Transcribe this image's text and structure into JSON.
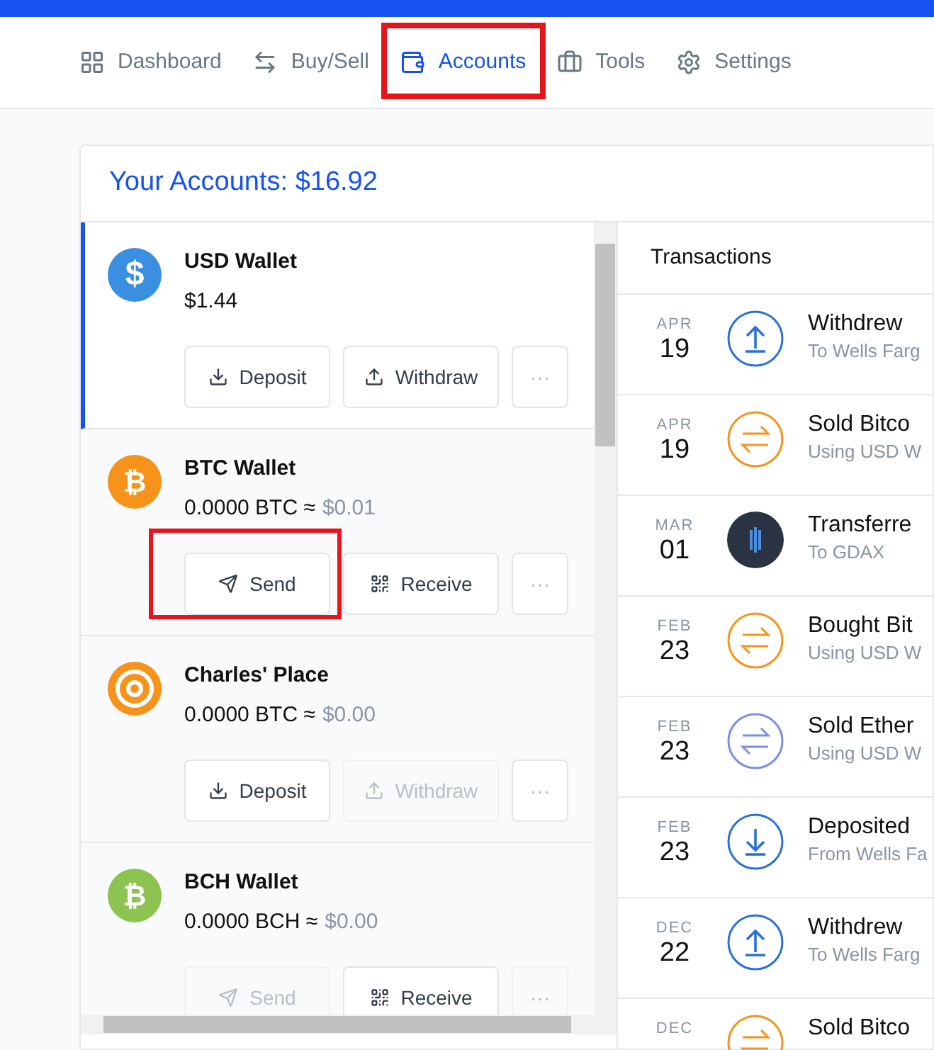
{
  "nav": [
    {
      "kind": "dashboard",
      "label": "Dashboard",
      "selected": false,
      "highlighted": false
    },
    {
      "kind": "buysell",
      "label": "Buy/Sell",
      "selected": false,
      "highlighted": false
    },
    {
      "kind": "accounts",
      "label": "Accounts",
      "selected": true,
      "highlighted": true
    },
    {
      "kind": "tools",
      "label": "Tools",
      "selected": false,
      "highlighted": false
    },
    {
      "kind": "settings",
      "label": "Settings",
      "selected": false,
      "highlighted": false
    }
  ],
  "accounts_title": "Your Accounts: $16.92",
  "accounts": [
    {
      "kind": "usd",
      "symbol": "$",
      "name": "USD Wallet",
      "amount": "$1.44",
      "selected": true,
      "buttons": [
        {
          "kind": "deposit",
          "label": "Deposit",
          "disabled": false,
          "highlighted": false
        },
        {
          "kind": "withdraw",
          "label": "Withdraw",
          "disabled": false,
          "highlighted": false
        },
        {
          "kind": "more",
          "label": "···",
          "disabled": false,
          "highlighted": false
        }
      ]
    },
    {
      "kind": "btc",
      "symbol": "₿",
      "name": "BTC Wallet",
      "amount": "0.0000 BTC ≈",
      "fiat": "$0.01",
      "selected": false,
      "buttons": [
        {
          "kind": "send",
          "label": "Send",
          "disabled": false,
          "highlighted": true
        },
        {
          "kind": "receive",
          "label": "Receive",
          "disabled": false,
          "highlighted": false
        },
        {
          "kind": "more",
          "label": "···",
          "disabled": false,
          "highlighted": false
        }
      ]
    },
    {
      "kind": "vault",
      "name": "Charles' Place",
      "amount": "0.0000 BTC ≈",
      "fiat": "$0.00",
      "selected": false,
      "buttons": [
        {
          "kind": "deposit",
          "label": "Deposit",
          "disabled": false,
          "highlighted": false
        },
        {
          "kind": "withdraw",
          "label": "Withdraw",
          "disabled": true,
          "highlighted": false
        },
        {
          "kind": "more",
          "label": "···",
          "disabled": false,
          "highlighted": false
        }
      ]
    },
    {
      "kind": "bch",
      "symbol": "₿",
      "name": "BCH Wallet",
      "amount": "0.0000 BCH ≈",
      "fiat": "$0.00",
      "selected": false,
      "buttons": [
        {
          "kind": "send",
          "label": "Send",
          "disabled": true,
          "highlighted": false
        },
        {
          "kind": "receive",
          "label": "Receive",
          "disabled": false,
          "highlighted": false
        },
        {
          "kind": "more",
          "label": "···",
          "disabled": true,
          "highlighted": false
        }
      ]
    }
  ],
  "transactions_title": "Transactions",
  "transactions": [
    {
      "month": "APR",
      "day": "19",
      "kind": "withdraw",
      "color": "#2b71d9",
      "title": "Withdrew",
      "subtitle": "To Wells Farg"
    },
    {
      "month": "APR",
      "day": "19",
      "kind": "exchange",
      "color": "#f7931a",
      "title": "Sold Bitco",
      "subtitle": "Using USD W"
    },
    {
      "month": "MAR",
      "day": "01",
      "kind": "transfer",
      "color": "#2b3343",
      "title": "Transferre",
      "subtitle": "To GDAX"
    },
    {
      "month": "FEB",
      "day": "23",
      "kind": "exchange",
      "color": "#f7931a",
      "title": "Bought Bit",
      "subtitle": "Using USD W"
    },
    {
      "month": "FEB",
      "day": "23",
      "kind": "exchange",
      "color": "#7b8ee6",
      "title": "Sold Ether",
      "subtitle": "Using USD W"
    },
    {
      "month": "FEB",
      "day": "23",
      "kind": "deposit",
      "color": "#2b71d9",
      "title": "Deposited",
      "subtitle": "From Wells Fa"
    },
    {
      "month": "DEC",
      "day": "22",
      "kind": "withdraw",
      "color": "#2b71d9",
      "title": "Withdrew",
      "subtitle": "To Wells Farg"
    },
    {
      "month": "DEC",
      "kind": "exchange",
      "color": "#f7931a",
      "title": "Sold Bitco"
    }
  ]
}
